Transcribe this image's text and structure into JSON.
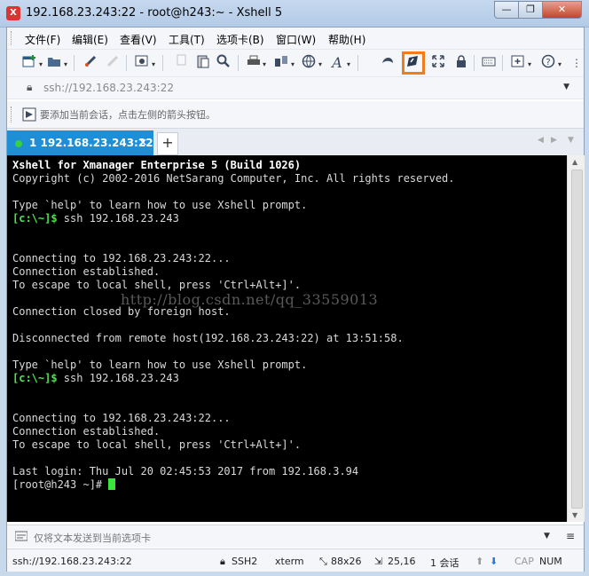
{
  "window": {
    "title": "192.168.23.243:22 - root@h243:~ - Xshell 5",
    "app_icon": "X",
    "min_glyph": "—",
    "max_glyph": "❐",
    "close_glyph": "✕"
  },
  "menu": {
    "items": [
      "文件(F)",
      "编辑(E)",
      "查看(V)",
      "工具(T)",
      "选项卡(B)",
      "窗口(W)",
      "帮助(H)"
    ]
  },
  "address": {
    "value": "ssh://192.168.23.243:22"
  },
  "hint": {
    "text": "要添加当前会话，点击左侧的箭头按钮。"
  },
  "tab": {
    "label": "1 192.168.23.243:22",
    "close": "×",
    "add": "+"
  },
  "terminal": {
    "lines": [
      "Xshell for Xmanager Enterprise 5 (Build 1026)",
      "Copyright (c) 2002-2016 NetSarang Computer, Inc. All rights reserved.",
      "",
      "Type `help' to learn how to use Xshell prompt.",
      "[c:\\~]$ ssh 192.168.23.243",
      "",
      "",
      "Connecting to 192.168.23.243:22...",
      "Connection established.",
      "To escape to local shell, press 'Ctrl+Alt+]'.",
      "",
      "Connection closed by foreign host.",
      "",
      "Disconnected from remote host(192.168.23.243:22) at 13:51:58.",
      "",
      "Type `help' to learn how to use Xshell prompt.",
      "[c:\\~]$ ssh 192.168.23.243",
      "",
      "",
      "Connecting to 192.168.23.243:22...",
      "Connection established.",
      "To escape to local shell, press 'Ctrl+Alt+]'.",
      "",
      "Last login: Thu Jul 20 02:45:53 2017 from 192.168.3.94",
      "[root@h243 ~]# "
    ],
    "watermark": "http://blog.csdn.net/qq_33559013"
  },
  "compose": {
    "placeholder": "仅将文本发送到当前选项卡"
  },
  "status": {
    "address": "ssh://192.168.23.243:22",
    "protocol": "SSH2",
    "terminal_type": "xterm",
    "size": "88x26",
    "position": "25,16",
    "sessions": "1 会话",
    "cap": "CAP",
    "num": "NUM"
  },
  "colors": {
    "tab_active": "#1e8fd6",
    "highlight_box": "#f07d1d",
    "prompt": "#4ee44e"
  }
}
